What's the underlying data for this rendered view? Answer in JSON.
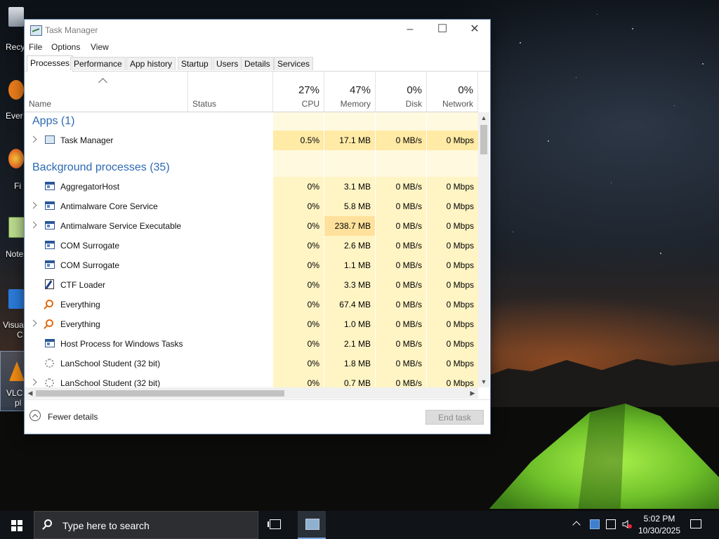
{
  "desktop": {
    "icons": [
      {
        "label": "Recy"
      },
      {
        "label": "Ever"
      },
      {
        "label": "Fi"
      },
      {
        "label": "Note"
      },
      {
        "label": "Visua"
      },
      {
        "label": "C"
      },
      {
        "label": "VLC"
      },
      {
        "label": "pl"
      }
    ]
  },
  "window": {
    "title": "Task Manager",
    "menu": [
      "File",
      "Options",
      "View"
    ],
    "tabs": [
      "Processes",
      "Performance",
      "App history",
      "Startup",
      "Users",
      "Details",
      "Services"
    ],
    "active_tab": "Processes"
  },
  "columns": {
    "name": "Name",
    "status": "Status",
    "cpu": {
      "pct": "27%",
      "label": "CPU"
    },
    "memory": {
      "pct": "47%",
      "label": "Memory"
    },
    "disk": {
      "pct": "0%",
      "label": "Disk"
    },
    "network": {
      "pct": "0%",
      "label": "Network"
    }
  },
  "groups": {
    "apps": "Apps (1)",
    "background": "Background processes (35)"
  },
  "apps": [
    {
      "name": "Task Manager",
      "cpu": "0.5%",
      "memory": "17.1 MB",
      "disk": "0 MB/s",
      "network": "0 Mbps",
      "icon": "task-manager-icon",
      "expandable": true
    }
  ],
  "background": [
    {
      "name": "AggregatorHost",
      "cpu": "0%",
      "memory": "3.1 MB",
      "disk": "0 MB/s",
      "network": "0 Mbps",
      "icon": "window-icon",
      "expandable": false
    },
    {
      "name": "Antimalware Core Service",
      "cpu": "0%",
      "memory": "5.8 MB",
      "disk": "0 MB/s",
      "network": "0 Mbps",
      "icon": "window-icon",
      "expandable": true
    },
    {
      "name": "Antimalware Service Executable",
      "cpu": "0%",
      "memory": "238.7 MB",
      "disk": "0 MB/s",
      "network": "0 Mbps",
      "icon": "window-icon",
      "expandable": true
    },
    {
      "name": "COM Surrogate",
      "cpu": "0%",
      "memory": "2.6 MB",
      "disk": "0 MB/s",
      "network": "0 Mbps",
      "icon": "window-icon",
      "expandable": false
    },
    {
      "name": "COM Surrogate",
      "cpu": "0%",
      "memory": "1.1 MB",
      "disk": "0 MB/s",
      "network": "0 Mbps",
      "icon": "window-icon",
      "expandable": false
    },
    {
      "name": "CTF Loader",
      "cpu": "0%",
      "memory": "3.3 MB",
      "disk": "0 MB/s",
      "network": "0 Mbps",
      "icon": "ctf-loader-icon",
      "expandable": false
    },
    {
      "name": "Everything",
      "cpu": "0%",
      "memory": "67.4 MB",
      "disk": "0 MB/s",
      "network": "0 Mbps",
      "icon": "everything-search-icon",
      "expandable": false
    },
    {
      "name": "Everything",
      "cpu": "0%",
      "memory": "1.0 MB",
      "disk": "0 MB/s",
      "network": "0 Mbps",
      "icon": "everything-search-icon",
      "expandable": true
    },
    {
      "name": "Host Process for Windows Tasks",
      "cpu": "0%",
      "memory": "2.1 MB",
      "disk": "0 MB/s",
      "network": "0 Mbps",
      "icon": "window-icon",
      "expandable": false
    },
    {
      "name": "LanSchool Student (32 bit)",
      "cpu": "0%",
      "memory": "1.8 MB",
      "disk": "0 MB/s",
      "network": "0 Mbps",
      "icon": "lanschool-icon",
      "expandable": false
    },
    {
      "name": "LanSchool Student (32 bit)",
      "cpu": "0%",
      "memory": "0.7 MB",
      "disk": "0 MB/s",
      "network": "0 Mbps",
      "icon": "lanschool-icon",
      "expandable": true
    }
  ],
  "footer": {
    "fewer_details": "Fewer details",
    "end_task": "End task"
  },
  "taskbar": {
    "search_placeholder": "Type here to search",
    "time": "5:02 PM",
    "date": "10/30/2025"
  }
}
